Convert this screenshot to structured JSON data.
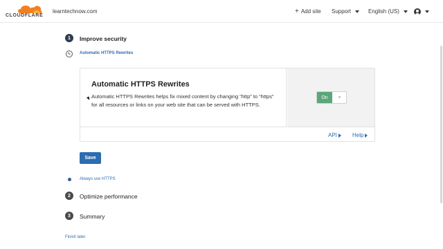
{
  "header": {
    "logo_text": "CLOUDFLARE",
    "domain": "learntechnow.com",
    "add_site_label": "Add site",
    "support_label": "Support",
    "language_label": "English (US)"
  },
  "steps": [
    {
      "number": "1",
      "title": "Improve security"
    },
    {
      "number": "2",
      "title": "Optimize performance"
    },
    {
      "number": "3",
      "title": "Summary"
    }
  ],
  "substeps": {
    "current": "Automatic HTTPS Rewrites",
    "next": "Always use HTTPS"
  },
  "card": {
    "title": "Automatic HTTPS Rewrites",
    "description": "Automatic HTTPS Rewrites helps fix mixed content by changing “http” to “https” for all resources or links on your web site that can be served with HTTPS.",
    "toggle_label": "On",
    "toggle_knob": "‹›",
    "api_link": "API",
    "help_link": "Help"
  },
  "save_label": "Save",
  "finish_later": "Finish later",
  "colors": {
    "brand_orange": "#f38020",
    "link_blue": "#2c6cb0",
    "toggle_green": "#5aa77a",
    "step_dark": "#2d3e50"
  },
  "icons": {
    "add": "plus-icon",
    "dropdown": "chevron-down-icon",
    "user": "user-icon",
    "edit": "pencil-icon",
    "link_arrow": "triangle-right-icon"
  }
}
